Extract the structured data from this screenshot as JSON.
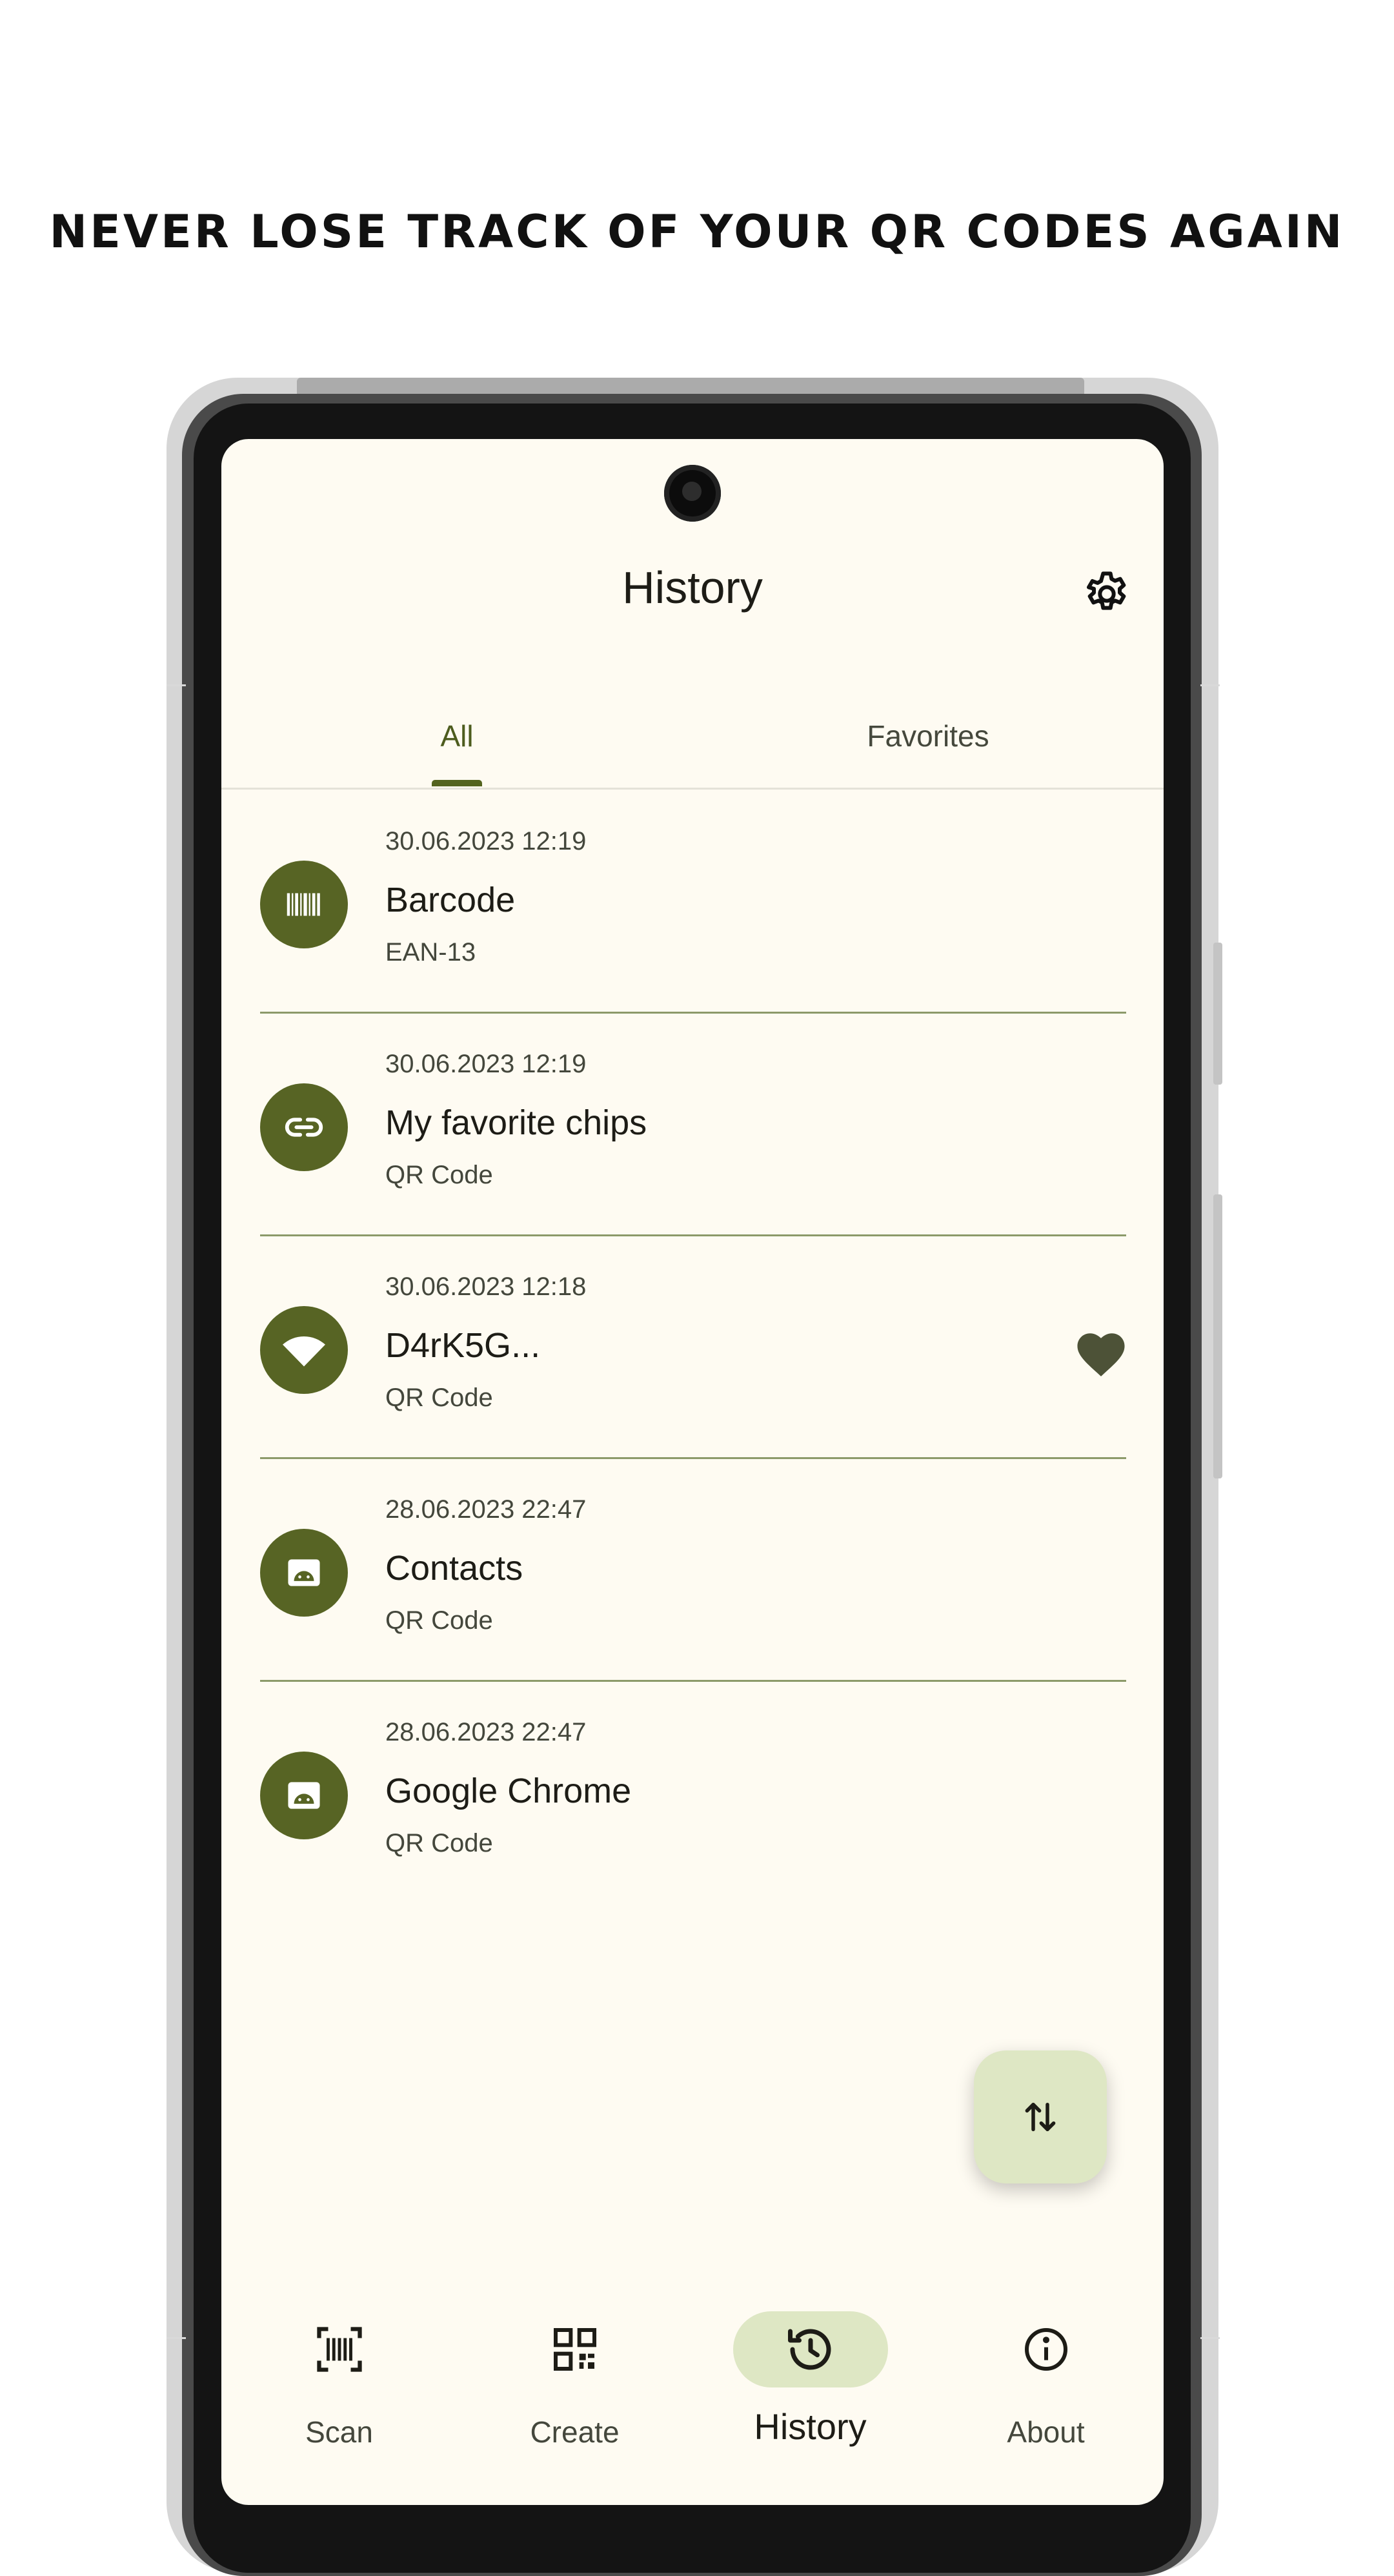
{
  "headline": "NEVER LOSE TRACK OF YOUR QR CODES AGAIN",
  "app": {
    "title": "History",
    "tabs": [
      {
        "label": "All",
        "active": true
      },
      {
        "label": "Favorites",
        "active": false
      }
    ],
    "items": [
      {
        "date": "30.06.2023 12:19",
        "name": "Barcode",
        "kind": "EAN-13",
        "icon": "barcode-icon",
        "favorite": false
      },
      {
        "date": "30.06.2023 12:19",
        "name": "My favorite chips",
        "kind": "QR Code",
        "icon": "link-icon",
        "favorite": false
      },
      {
        "date": "30.06.2023 12:18",
        "name": "D4rK5G...",
        "kind": "QR Code",
        "icon": "wifi-icon",
        "favorite": true
      },
      {
        "date": "28.06.2023 22:47",
        "name": "Contacts",
        "kind": "QR Code",
        "icon": "android-app-icon",
        "favorite": false
      },
      {
        "date": "28.06.2023 22:47",
        "name": "Google Chrome",
        "kind": "QR Code",
        "icon": "android-app-icon",
        "favorite": false
      }
    ],
    "nav": [
      {
        "label": "Scan",
        "icon": "barcode-scan-icon",
        "active": false
      },
      {
        "label": "Create",
        "icon": "qr-code-icon",
        "active": false
      },
      {
        "label": "History",
        "icon": "history-icon",
        "active": true
      },
      {
        "label": "About",
        "icon": "info-icon",
        "active": false
      }
    ],
    "colors": {
      "accent": "#576424",
      "accent_container": "#dee7c4",
      "surface": "#fefbf2",
      "divider": "#8c9a6a"
    }
  }
}
